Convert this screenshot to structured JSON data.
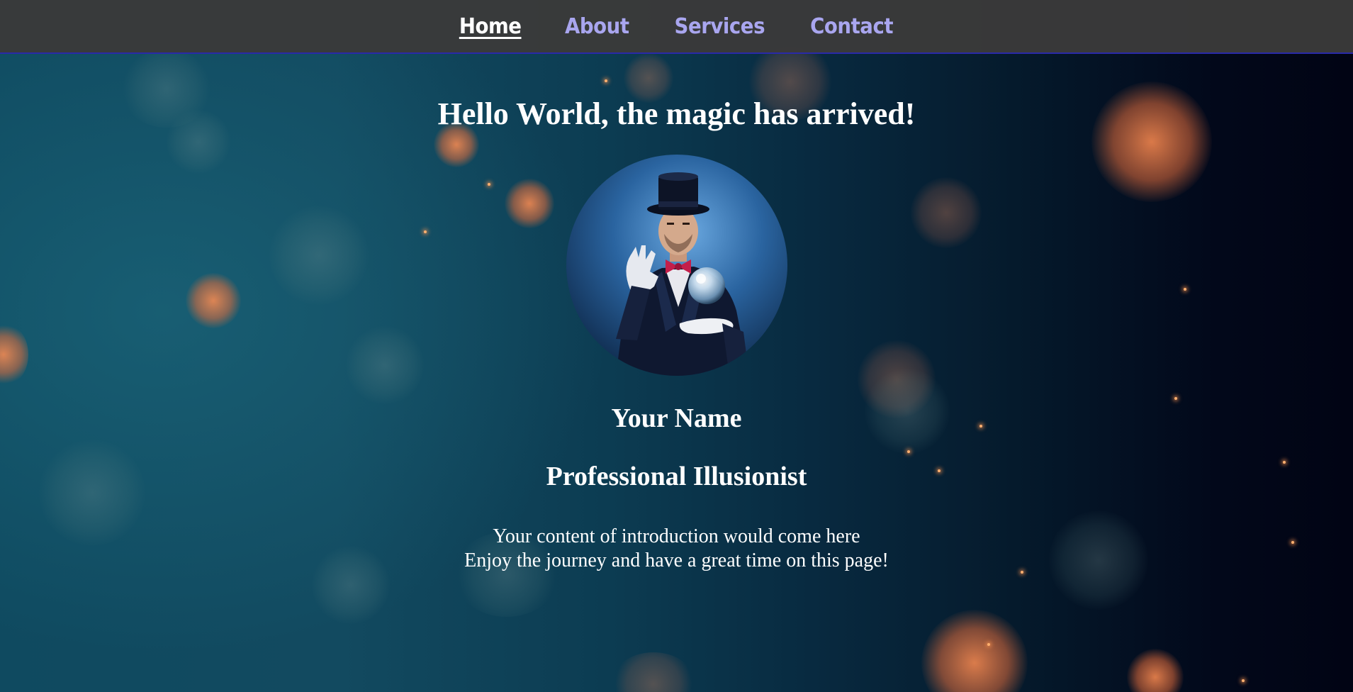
{
  "nav": {
    "items": [
      {
        "label": "Home",
        "active": true
      },
      {
        "label": "About",
        "active": false
      },
      {
        "label": "Services",
        "active": false
      },
      {
        "label": "Contact",
        "active": false
      }
    ]
  },
  "hero": {
    "headline": "Hello World, the magic has arrived!",
    "portrait_alt": "magician-portrait",
    "name": "Your Name",
    "title": "Professional Illusionist",
    "intro_line_1": "Your content of introduction would come here",
    "intro_line_2": "Enjoy the journey and have a great time on this page!"
  },
  "colors": {
    "nav_background": "#3a3a3a",
    "nav_link": "#a9a6ef",
    "nav_active": "#ffffff",
    "nav_border": "#2a2aa8",
    "text": "#ffffff"
  }
}
